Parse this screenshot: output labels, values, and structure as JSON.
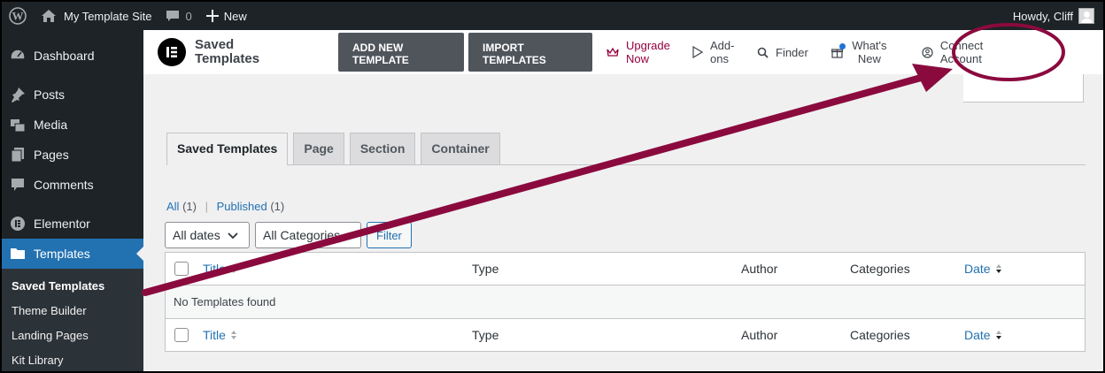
{
  "admin_bar": {
    "site_name": "My Template Site",
    "comments_count": "0",
    "new_label": "New",
    "greeting": "Howdy, Cliff"
  },
  "sidebar": {
    "items": [
      {
        "label": "Dashboard",
        "icon": "dashboard-icon"
      },
      {
        "label": "Posts",
        "icon": "pin-icon"
      },
      {
        "label": "Media",
        "icon": "media-icon"
      },
      {
        "label": "Pages",
        "icon": "pages-icon"
      },
      {
        "label": "Comments",
        "icon": "comment-icon"
      },
      {
        "label": "Elementor",
        "icon": "elementor-icon"
      },
      {
        "label": "Templates",
        "icon": "folder-icon"
      }
    ],
    "submenu": [
      "Saved Templates",
      "Theme Builder",
      "Landing Pages",
      "Kit Library"
    ]
  },
  "elementor_bar": {
    "title": "Saved Templates",
    "add_new": "ADD NEW TEMPLATE",
    "import": "IMPORT TEMPLATES",
    "upgrade": "Upgrade Now",
    "addons": "Add-ons",
    "finder": "Finder",
    "whats_new": "What's New",
    "connect": "Connect Account"
  },
  "tabs": [
    "Saved Templates",
    "Page",
    "Section",
    "Container"
  ],
  "views": {
    "all": "All",
    "all_count": "(1)",
    "separator": "|",
    "published": "Published",
    "published_count": "(1)"
  },
  "filters": {
    "dates": "All dates",
    "categories": "All Categories",
    "filter_button": "Filter"
  },
  "table": {
    "columns": [
      "Title",
      "Type",
      "Author",
      "Categories",
      "Date"
    ],
    "empty_message": "No Templates found"
  },
  "colors": {
    "admin_dark": "#1d2327",
    "accent_blue": "#2271b1",
    "upgrade_red": "#93003f",
    "annotation": "#8b0a3e"
  }
}
